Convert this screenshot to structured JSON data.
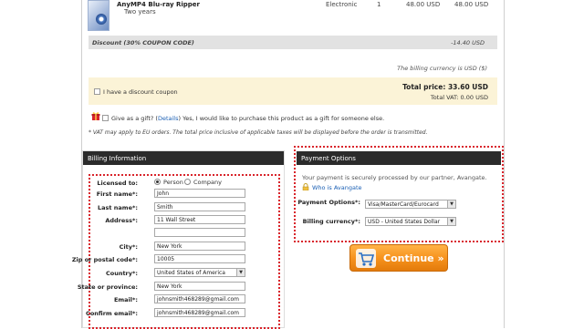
{
  "order": {
    "product_name": "AnyMP4 Blu-ray Ripper",
    "product_term": "Two years",
    "delivery": "Electronic",
    "quantity": "1",
    "unit_price": "48.00 USD",
    "line_total": "48.00 USD",
    "discount_label": "Discount (30% COUPON CODE)",
    "discount_amount": "-14.40 USD",
    "billing_currency_note": "The billing currency is USD ($)",
    "total_price": "Total price: 33.60 USD",
    "total_vat": "Total VAT: 0.00 USD"
  },
  "coupon": {
    "label": "I have a discount coupon",
    "checked": false
  },
  "gift": {
    "prefix": "Give as a gift? (",
    "link": "Details",
    "suffix": ") Yes, I would like to purchase this product as a gift for someone else.",
    "checked": false
  },
  "vat_note": "* VAT may apply to EU orders. The total price inclusive of applicable taxes will be displayed before the order is transmitted.",
  "billing": {
    "title": "Billing Information",
    "licensed_to_label": "Licensed to:",
    "licensed_to_options": [
      "Person",
      "Company"
    ],
    "licensed_to_selected": "Person",
    "first_name_label": "First name*:",
    "first_name": "John",
    "last_name_label": "Last name*:",
    "last_name": "Smith",
    "address_label": "Address*:",
    "address_line1": "11 Wall Street",
    "address_line2": "",
    "city_label": "City*:",
    "city": "New York",
    "zip_label": "Zip or postal code*:",
    "zip": "10005",
    "country_label": "Country*:",
    "country": "United States of America",
    "state_label": "State or province:",
    "state": "New York",
    "email_label": "Email*:",
    "email": "johnsmith468289@gmail.com",
    "confirm_email_label": "Confirm email*:",
    "confirm_email": "johnsmith468289@gmail.com"
  },
  "payment": {
    "title": "Payment Options",
    "note": "Your payment is securely processed by our partner, Avangate.",
    "who_link": "Who is Avangate",
    "options_label": "Payment Options*:",
    "options_value": "Visa/MasterCard/Eurocard",
    "currency_label": "Billing currency*:",
    "currency_value": "USD - United States Dollar"
  },
  "continue_label": "Continue »",
  "colors": {
    "accent_orange": "#f7931e",
    "dotted_red": "#d9242b",
    "panel_header": "#2b2b2b"
  }
}
